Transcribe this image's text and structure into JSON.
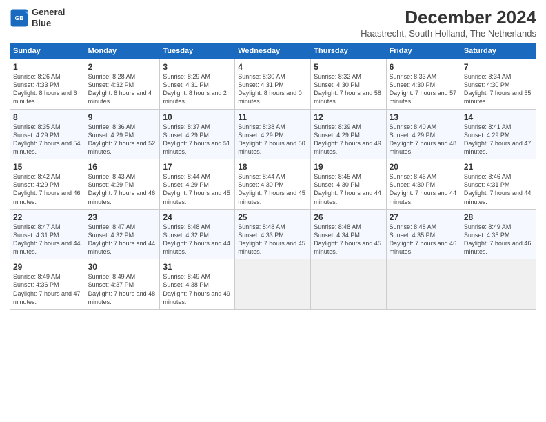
{
  "logo": {
    "line1": "General",
    "line2": "Blue"
  },
  "title": "December 2024",
  "subtitle": "Haastrecht, South Holland, The Netherlands",
  "weekdays": [
    "Sunday",
    "Monday",
    "Tuesday",
    "Wednesday",
    "Thursday",
    "Friday",
    "Saturday"
  ],
  "weeks": [
    [
      {
        "day": "1",
        "sunrise": "8:26 AM",
        "sunset": "4:33 PM",
        "daylight": "8 hours and 6 minutes."
      },
      {
        "day": "2",
        "sunrise": "8:28 AM",
        "sunset": "4:32 PM",
        "daylight": "8 hours and 4 minutes."
      },
      {
        "day": "3",
        "sunrise": "8:29 AM",
        "sunset": "4:31 PM",
        "daylight": "8 hours and 2 minutes."
      },
      {
        "day": "4",
        "sunrise": "8:30 AM",
        "sunset": "4:31 PM",
        "daylight": "8 hours and 0 minutes."
      },
      {
        "day": "5",
        "sunrise": "8:32 AM",
        "sunset": "4:30 PM",
        "daylight": "7 hours and 58 minutes."
      },
      {
        "day": "6",
        "sunrise": "8:33 AM",
        "sunset": "4:30 PM",
        "daylight": "7 hours and 57 minutes."
      },
      {
        "day": "7",
        "sunrise": "8:34 AM",
        "sunset": "4:30 PM",
        "daylight": "7 hours and 55 minutes."
      }
    ],
    [
      {
        "day": "8",
        "sunrise": "8:35 AM",
        "sunset": "4:29 PM",
        "daylight": "7 hours and 54 minutes."
      },
      {
        "day": "9",
        "sunrise": "8:36 AM",
        "sunset": "4:29 PM",
        "daylight": "7 hours and 52 minutes."
      },
      {
        "day": "10",
        "sunrise": "8:37 AM",
        "sunset": "4:29 PM",
        "daylight": "7 hours and 51 minutes."
      },
      {
        "day": "11",
        "sunrise": "8:38 AM",
        "sunset": "4:29 PM",
        "daylight": "7 hours and 50 minutes."
      },
      {
        "day": "12",
        "sunrise": "8:39 AM",
        "sunset": "4:29 PM",
        "daylight": "7 hours and 49 minutes."
      },
      {
        "day": "13",
        "sunrise": "8:40 AM",
        "sunset": "4:29 PM",
        "daylight": "7 hours and 48 minutes."
      },
      {
        "day": "14",
        "sunrise": "8:41 AM",
        "sunset": "4:29 PM",
        "daylight": "7 hours and 47 minutes."
      }
    ],
    [
      {
        "day": "15",
        "sunrise": "8:42 AM",
        "sunset": "4:29 PM",
        "daylight": "7 hours and 46 minutes."
      },
      {
        "day": "16",
        "sunrise": "8:43 AM",
        "sunset": "4:29 PM",
        "daylight": "7 hours and 46 minutes."
      },
      {
        "day": "17",
        "sunrise": "8:44 AM",
        "sunset": "4:29 PM",
        "daylight": "7 hours and 45 minutes."
      },
      {
        "day": "18",
        "sunrise": "8:44 AM",
        "sunset": "4:30 PM",
        "daylight": "7 hours and 45 minutes."
      },
      {
        "day": "19",
        "sunrise": "8:45 AM",
        "sunset": "4:30 PM",
        "daylight": "7 hours and 44 minutes."
      },
      {
        "day": "20",
        "sunrise": "8:46 AM",
        "sunset": "4:30 PM",
        "daylight": "7 hours and 44 minutes."
      },
      {
        "day": "21",
        "sunrise": "8:46 AM",
        "sunset": "4:31 PM",
        "daylight": "7 hours and 44 minutes."
      }
    ],
    [
      {
        "day": "22",
        "sunrise": "8:47 AM",
        "sunset": "4:31 PM",
        "daylight": "7 hours and 44 minutes."
      },
      {
        "day": "23",
        "sunrise": "8:47 AM",
        "sunset": "4:32 PM",
        "daylight": "7 hours and 44 minutes."
      },
      {
        "day": "24",
        "sunrise": "8:48 AM",
        "sunset": "4:32 PM",
        "daylight": "7 hours and 44 minutes."
      },
      {
        "day": "25",
        "sunrise": "8:48 AM",
        "sunset": "4:33 PM",
        "daylight": "7 hours and 45 minutes."
      },
      {
        "day": "26",
        "sunrise": "8:48 AM",
        "sunset": "4:34 PM",
        "daylight": "7 hours and 45 minutes."
      },
      {
        "day": "27",
        "sunrise": "8:48 AM",
        "sunset": "4:35 PM",
        "daylight": "7 hours and 46 minutes."
      },
      {
        "day": "28",
        "sunrise": "8:49 AM",
        "sunset": "4:35 PM",
        "daylight": "7 hours and 46 minutes."
      }
    ],
    [
      {
        "day": "29",
        "sunrise": "8:49 AM",
        "sunset": "4:36 PM",
        "daylight": "7 hours and 47 minutes."
      },
      {
        "day": "30",
        "sunrise": "8:49 AM",
        "sunset": "4:37 PM",
        "daylight": "7 hours and 48 minutes."
      },
      {
        "day": "31",
        "sunrise": "8:49 AM",
        "sunset": "4:38 PM",
        "daylight": "7 hours and 49 minutes."
      },
      null,
      null,
      null,
      null
    ]
  ]
}
